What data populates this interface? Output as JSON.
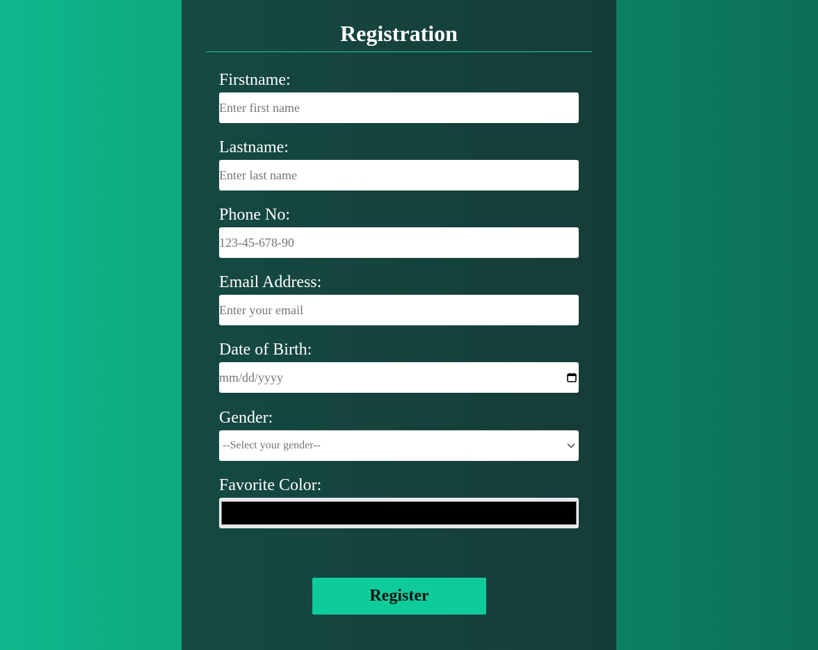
{
  "form": {
    "title": "Registration",
    "fields": [
      {
        "label": "Firstname:",
        "placeholder": "Enter first name"
      },
      {
        "label": "Lastname:",
        "placeholder": "Enter last name"
      },
      {
        "label": "Phone No:",
        "placeholder": "123-45-678-90"
      },
      {
        "label": "Email Address:",
        "placeholder": "Enter your email"
      },
      {
        "label": "Date of Birth:",
        "placeholder": "mm/dd/yyyy"
      },
      {
        "label": "Gender:",
        "selected": "--Select your gender--"
      },
      {
        "label": "Favorite Color:",
        "value": "#000000"
      }
    ],
    "submit_label": "Register"
  },
  "colors": {
    "page_background": "#0fb88c",
    "card_background": "#154540",
    "accent": "#0ecb9a",
    "divider": "#22c79a"
  },
  "icons": {
    "date_picker": "calendar-icon",
    "select": "chevron-down-icon"
  }
}
